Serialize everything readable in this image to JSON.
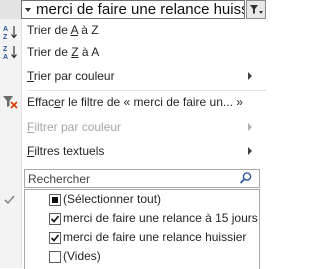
{
  "header": {
    "cell_value": "merci de faire une relance huissier"
  },
  "menu": {
    "sort_az": {
      "before": "Trier de ",
      "key": "A",
      "mid": " à ",
      "end": "Z"
    },
    "sort_za": {
      "before": "Trier de ",
      "key": "Z",
      "mid": " à ",
      "end": "A"
    },
    "sort_color": {
      "before": "",
      "key": "T",
      "rest": "rier par couleur"
    },
    "clear_filter": {
      "before": "Effac",
      "key": "e",
      "rest": "r le filtre de « merci de faire un... »"
    },
    "filter_color": {
      "before": "",
      "key": "F",
      "rest": "iltrer par couleur"
    },
    "text_filters": {
      "before": "",
      "key": "F",
      "rest": "iltres textuels"
    }
  },
  "search": {
    "placeholder": "Rechercher"
  },
  "values_list": {
    "items": [
      {
        "label": "(Sélectionner tout)",
        "state": "partial"
      },
      {
        "label": "merci de faire une relance à 15 jours",
        "state": "checked"
      },
      {
        "label": "merci de faire une relance huissier",
        "state": "checked"
      },
      {
        "label": "(Vides)",
        "state": "unchecked"
      }
    ]
  },
  "colors": {
    "icon_blue": "#2b579a",
    "clear_red": "#d83b01",
    "disabled_text": "#a6a6a6"
  }
}
